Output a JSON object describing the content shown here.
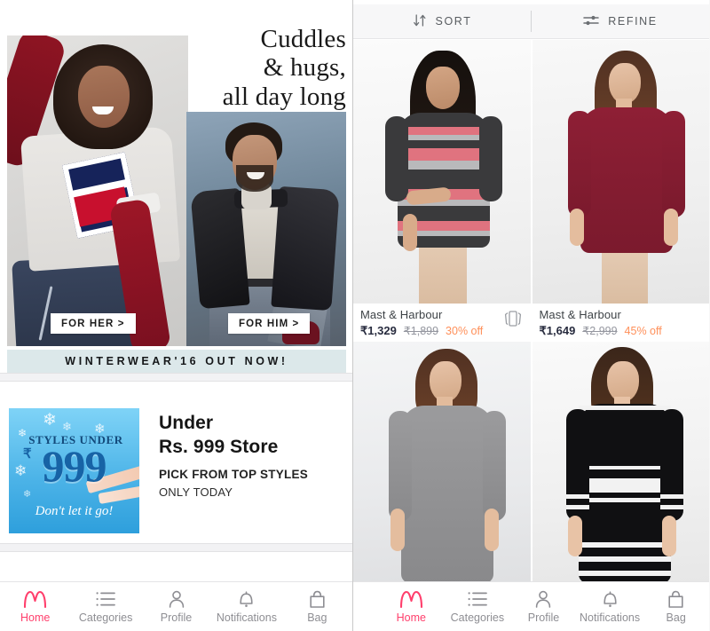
{
  "app": {
    "name": "Myntra",
    "brand_color": "#ff3f6c",
    "discount_color": "#ff905a"
  },
  "left_screen": {
    "hero_banner": {
      "headline_lines": [
        "Cuddles",
        "& hugs,",
        "all day long"
      ],
      "cta_her": "FOR HER >",
      "cta_him": "FOR HIM >",
      "strip_text": "WINTERWEAR'16 OUT NOW!",
      "strip_color": "#dce8ea",
      "her_image_alt": "woman-in-tommy-jeans-sweatshirt",
      "him_image_alt": "man-in-black-leather-jacket"
    },
    "promo_banner": {
      "thumb": {
        "styles_under": "STYLES UNDER",
        "rupee": "₹",
        "amount": "999",
        "tagline": "Don't let it go!"
      },
      "title_line1": "Under",
      "title_line2": "Rs. 999 Store",
      "subtitle": "PICK FROM TOP STYLES",
      "subtitle2": "ONLY TODAY"
    }
  },
  "right_screen": {
    "toolbar": {
      "sort_label": "SORT",
      "sort_icon": "sort-arrows-icon",
      "refine_label": "REFINE",
      "refine_icon": "sliders-icon"
    },
    "products": [
      {
        "brand": "Mast & Harbour",
        "price": "₹1,329",
        "original_price": "₹1,899",
        "discount": "30% off",
        "has_tryon_icon": true,
        "tryon_icon": "try-on-icon",
        "image_alt": "charcoal-pink-striped-sweater-dress"
      },
      {
        "brand": "Mast & Harbour",
        "price": "₹1,649",
        "original_price": "₹2,999",
        "discount": "45% off",
        "has_tryon_icon": false,
        "tryon_icon": "",
        "image_alt": "maroon-bodycon-sweater-dress"
      },
      {
        "brand": "",
        "price": "",
        "original_price": "",
        "discount": "",
        "has_tryon_icon": false,
        "tryon_icon": "",
        "image_alt": "grey-bodycon-sweater-dress"
      },
      {
        "brand": "",
        "price": "",
        "original_price": "",
        "discount": "",
        "has_tryon_icon": false,
        "tryon_icon": "",
        "image_alt": "black-white-striped-bodycon-dress"
      }
    ]
  },
  "bottom_nav": {
    "items": [
      {
        "label": "Home",
        "icon": "myntra-logo-icon",
        "active": true
      },
      {
        "label": "Categories",
        "icon": "list-icon",
        "active": false
      },
      {
        "label": "Profile",
        "icon": "person-icon",
        "active": false
      },
      {
        "label": "Notifications",
        "icon": "bell-icon",
        "active": false
      },
      {
        "label": "Bag",
        "icon": "bag-icon",
        "active": false
      }
    ]
  }
}
